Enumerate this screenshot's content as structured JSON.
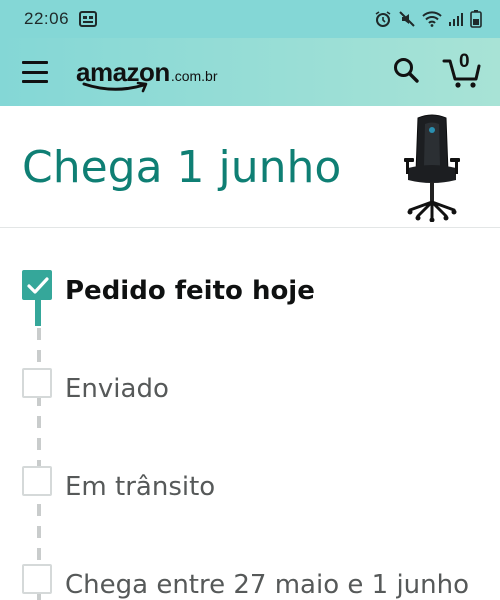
{
  "status_bar": {
    "time": "22:06",
    "left_icons": [
      "gallery-icon"
    ],
    "right_icons": [
      "alarm-icon",
      "mute-icon",
      "wifi-icon",
      "signal-icon",
      "battery-icon"
    ]
  },
  "header": {
    "logo_word": "amazon",
    "logo_tld": ".com.br",
    "cart_count": "0",
    "colors": {
      "gradient_start": "#84d7d6",
      "gradient_end": "#a8e3d6"
    }
  },
  "delivery": {
    "title": "Chega 1 junho",
    "title_color": "#0f7f74",
    "product_image": "gaming-chair-image"
  },
  "timeline": {
    "accent_color": "#35a79a",
    "steps": [
      {
        "label": "Pedido feito hoje",
        "done": true
      },
      {
        "label": "Enviado",
        "done": false
      },
      {
        "label": "Em trânsito",
        "done": false
      },
      {
        "label": "Chega entre 27 maio e 1 junho",
        "done": false
      }
    ]
  }
}
